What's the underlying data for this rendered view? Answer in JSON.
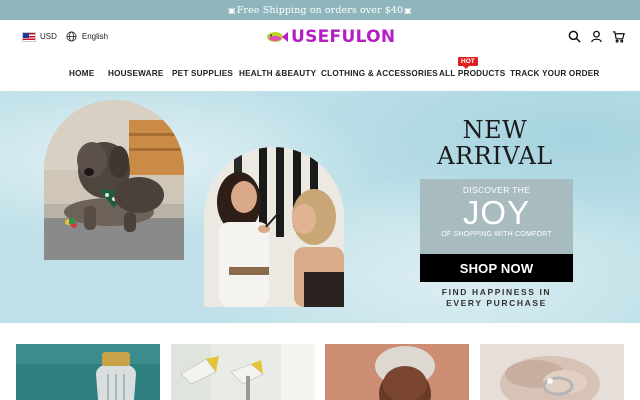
{
  "announcement": {
    "text": "Free Shipping on orders over $40"
  },
  "header": {
    "currency": "USD",
    "language": "English",
    "brand_name": "USEFULON"
  },
  "nav": {
    "items": [
      {
        "label": "HOME"
      },
      {
        "label": "HOUSEWARE"
      },
      {
        "label": "PET SUPPLIES"
      },
      {
        "label": "HEALTH &BEAUTY"
      },
      {
        "label": "CLOTHING & ACCESSORIES"
      },
      {
        "label": "ALL PRODUCTS"
      },
      {
        "label": "TRACK YOUR ORDER"
      }
    ],
    "hot_badge": "HOT"
  },
  "hero": {
    "headline_line1": "NEW",
    "headline_line2": "ARRIVAL",
    "promo_top": "DISCOVER THE",
    "promo_main": "JOY",
    "promo_bottom": "OF SHOPPING WITH COMFORT",
    "cta_label": "SHOP NOW",
    "tagline_line1": "FIND HAPPINESS IN",
    "tagline_line2": "EVERY PURCHASE"
  },
  "icons": {
    "flag": "us-flag-icon",
    "language": "globe-icon",
    "logo": "fish-logo-icon",
    "search": "search-icon",
    "account": "user-icon",
    "cart": "cart-icon"
  },
  "colors": {
    "announcement_bg": "#8fb6bd",
    "brand": "#b51ec5",
    "hero_bg": "#bfe0e8",
    "promo_box": "#a8bcbf",
    "hot_badge": "#e02020"
  }
}
